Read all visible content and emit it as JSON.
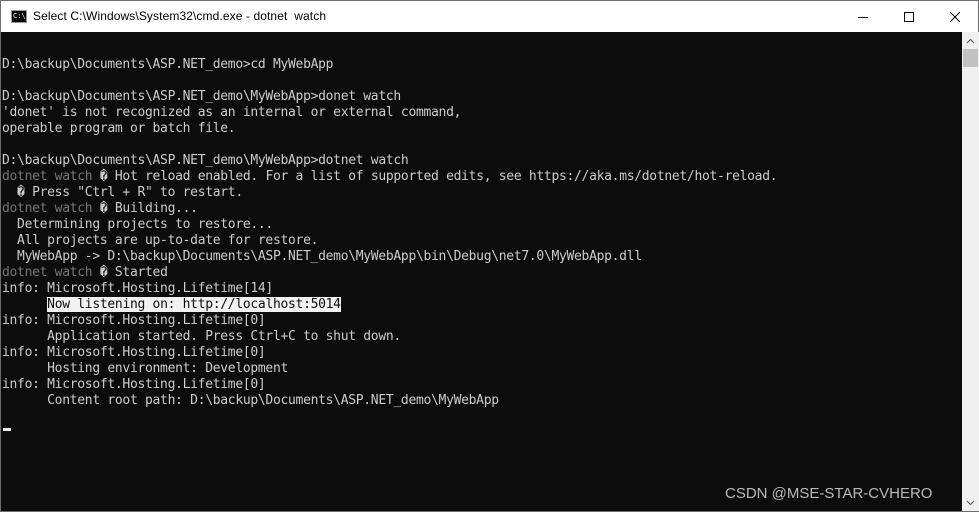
{
  "window": {
    "title": "Select C:\\Windows\\System32\\cmd.exe - dotnet  watch",
    "app_icon_text": "C:\\",
    "controls": [
      "minimize-icon",
      "maximize-icon",
      "close-icon"
    ]
  },
  "console": {
    "lines": [
      {
        "text": ""
      },
      {
        "text": "D:\\backup\\Documents\\ASP.NET_demo>cd MyWebApp"
      },
      {
        "text": ""
      },
      {
        "text": "D:\\backup\\Documents\\ASP.NET_demo\\MyWebApp>donet watch"
      },
      {
        "text": "'donet' is not recognized as an internal or external command,"
      },
      {
        "text": "operable program or batch file."
      },
      {
        "text": ""
      },
      {
        "text": "D:\\backup\\Documents\\ASP.NET_demo\\MyWebApp>dotnet watch"
      },
      {
        "prefix": "dotnet watch",
        "text": " � Hot reload enabled. For a list of supported edits, see https://aka.ms/dotnet/hot-reload."
      },
      {
        "text": "  � Press \"Ctrl + R\" to restart."
      },
      {
        "prefix": "dotnet watch",
        "text": " � Building..."
      },
      {
        "text": "  Determining projects to restore..."
      },
      {
        "text": "  All projects are up-to-date for restore."
      },
      {
        "text": "  MyWebApp -> D:\\backup\\Documents\\ASP.NET_demo\\MyWebApp\\bin\\Debug\\net7.0\\MyWebApp.dll"
      },
      {
        "prefix": "dotnet watch",
        "text": " � Started"
      },
      {
        "text": "info: Microsoft.Hosting.Lifetime[14]"
      },
      {
        "indent": "      ",
        "highlight": "Now listening on: http://localhost:5014"
      },
      {
        "text": "info: Microsoft.Hosting.Lifetime[0]"
      },
      {
        "text": "      Application started. Press Ctrl+C to shut down."
      },
      {
        "text": "info: Microsoft.Hosting.Lifetime[0]"
      },
      {
        "text": "      Hosting environment: Development"
      },
      {
        "text": "info: Microsoft.Hosting.Lifetime[0]"
      },
      {
        "text": "      Content root path: D:\\backup\\Documents\\ASP.NET_demo\\MyWebApp"
      }
    ]
  },
  "watermark": "CSDN @MSE-STAR-CVHERO",
  "colors": {
    "background": "#0c0c0c",
    "foreground": "#cccccc",
    "dim": "#767676",
    "selection_bg": "#f2f2f2"
  }
}
